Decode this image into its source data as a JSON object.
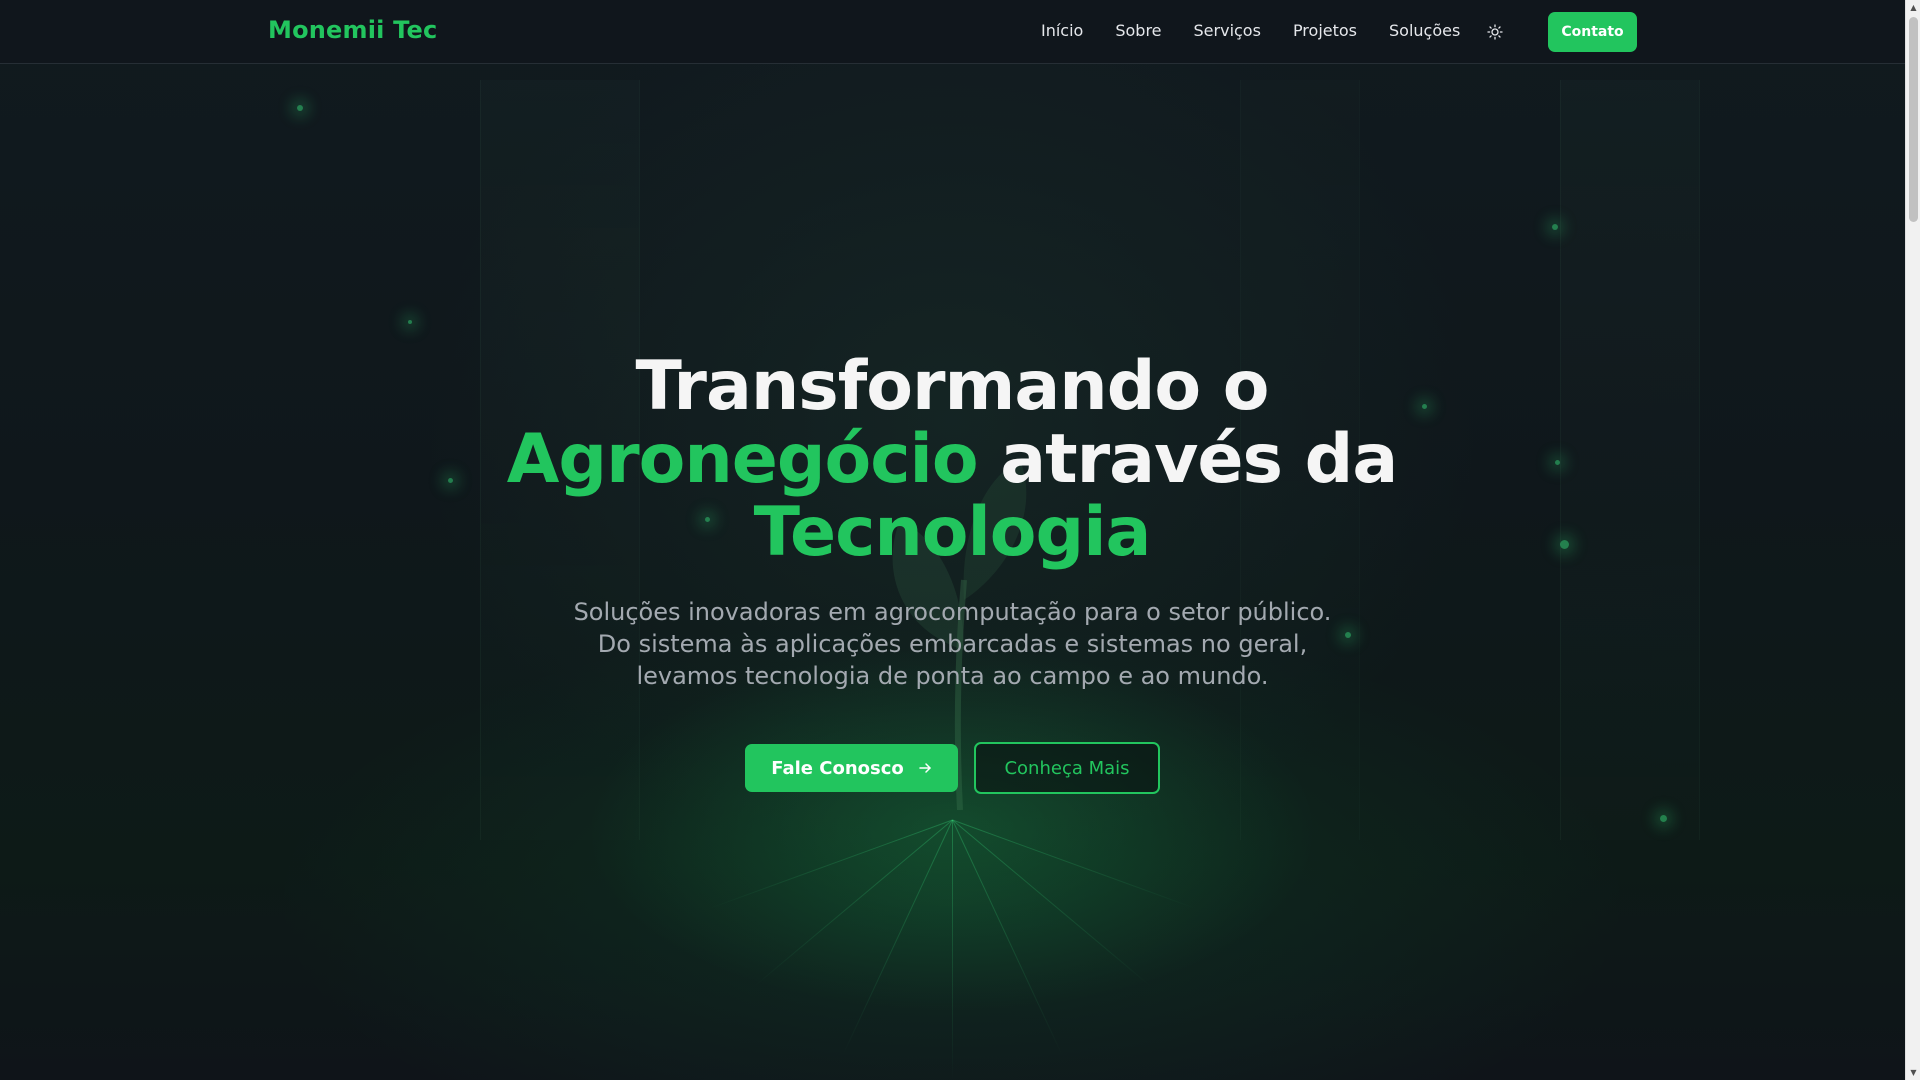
{
  "nav": {
    "brand": "Monemii Tec",
    "links": [
      "Início",
      "Sobre",
      "Serviços",
      "Projetos",
      "Soluções"
    ],
    "theme_toggle_icon": "sun-icon",
    "contact_label": "Contato"
  },
  "hero": {
    "title_line1": "Transformando o",
    "title_highlight1": "Agronegócio",
    "title_mid": " através da",
    "title_highlight2": "Tecnologia",
    "subtitle": "Soluções inovadoras em agrocomputação para o setor público. Do sistema às aplicações embarcadas e sistemas no geral, levamos tecnologia de ponta ao campo e ao mundo.",
    "primary_cta": "Fale Conosco",
    "primary_cta_icon": "arrow-right-icon",
    "secondary_cta": "Conheça Mais"
  },
  "colors": {
    "accent": "#22c55e",
    "background": "#0f1419",
    "nav_background": "#10161c",
    "text": "#f5f5f5",
    "muted_text": "#a3a9b0"
  }
}
